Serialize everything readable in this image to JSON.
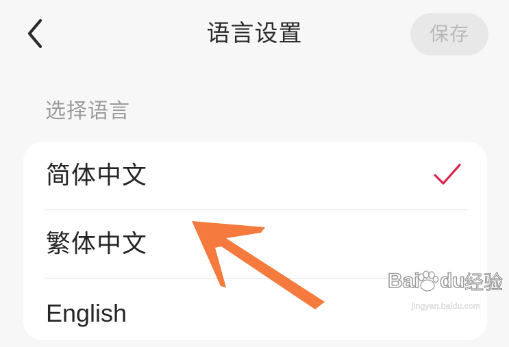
{
  "header": {
    "title": "语言设置",
    "save_label": "保存"
  },
  "section": {
    "label": "选择语言"
  },
  "languages": [
    {
      "label": "简体中文",
      "selected": true
    },
    {
      "label": "繁体中文",
      "selected": false
    },
    {
      "label": "English",
      "selected": false
    }
  ],
  "watermark": {
    "brand_part1": "Bai",
    "brand_part2": "du",
    "brand_part3": "经验",
    "url": "jingyan.baidu.com"
  },
  "icons": {
    "back": "chevron-left-icon",
    "check": "check-icon",
    "annotation": "orange-arrow"
  },
  "colors": {
    "accent": "#d9254c",
    "arrow": "#f47a3e",
    "background": "#f7f7f7"
  }
}
